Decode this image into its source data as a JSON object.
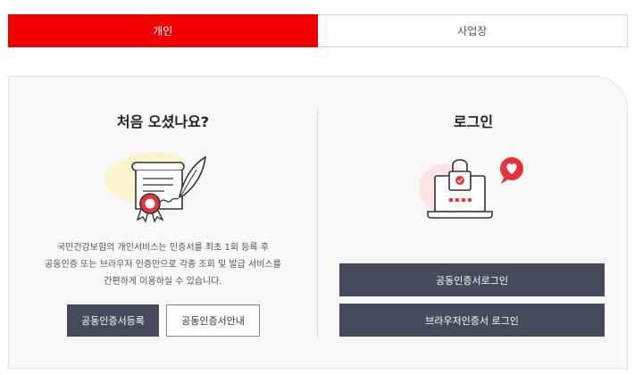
{
  "tabs": [
    {
      "label": "개인",
      "active": true
    },
    {
      "label": "사업장",
      "active": false
    }
  ],
  "left": {
    "heading": "처음 오셨나요?",
    "description": [
      "국민건강보험의 개인서비스는 인증서를 최초 1회 등록 후",
      "공동인증 또는 브라우저 인증만으로 각종 조회 및 발급 서비스를",
      "간편하게 이용하실 수 있습니다."
    ],
    "buttons": {
      "register": "공동인증서등록",
      "guide": "공동인증서안내"
    },
    "illustration_icon": "certificate-scroll-quill-icon"
  },
  "right": {
    "heading": "로그인",
    "buttons": {
      "joint_login": "공동인증서로그인",
      "browser_login": "브라우저인증서 로그인"
    },
    "illustration_icon": "locked-laptop-heart-icon"
  },
  "colors": {
    "accent": "#f00000",
    "button_dark": "#464a5c",
    "panel_bg": "#f8f8f8"
  }
}
